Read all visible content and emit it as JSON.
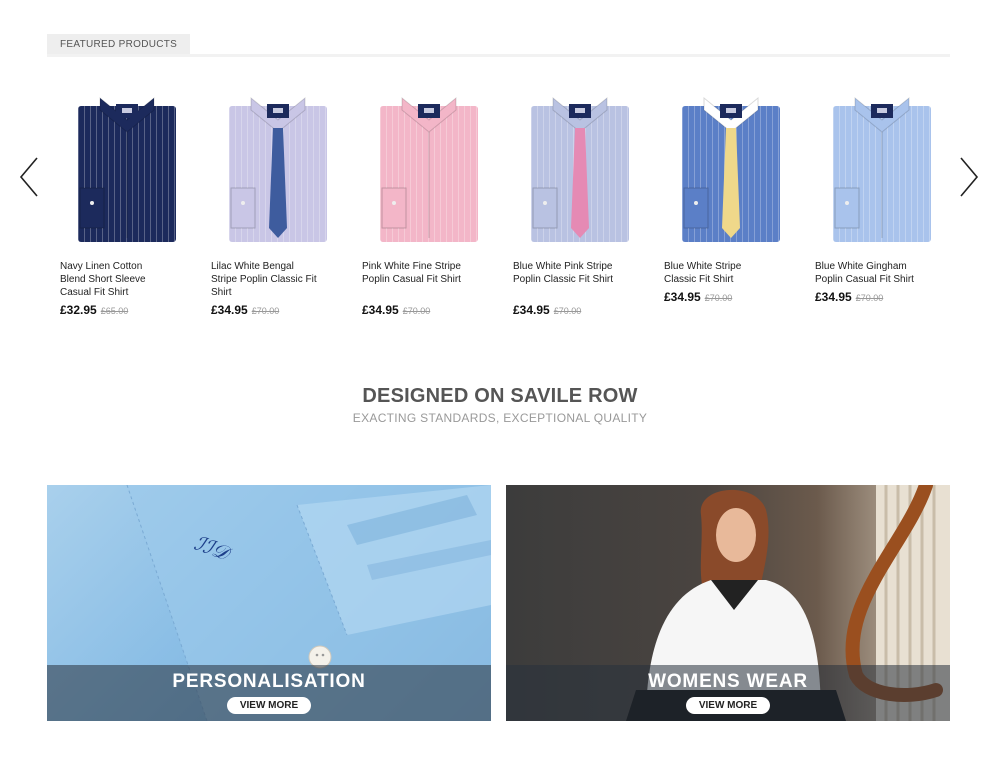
{
  "featured": {
    "tab_label": "FEATURED PRODUCTS"
  },
  "carousel": {
    "prev_icon": "chevron-left-icon",
    "next_icon": "chevron-right-icon"
  },
  "products": [
    {
      "name": "Navy Linen Cotton Blend Short Sleeve Casual Fit Shirt",
      "price": "£32.95",
      "was": "£65.00",
      "shirt_color": "#1c2a5c",
      "collar_color": "#1c2a5c",
      "tie": false,
      "tie_color": ""
    },
    {
      "name": "Lilac White Bengal Stripe Poplin Classic Fit Shirt",
      "price": "£34.95",
      "was": "£70.00",
      "shirt_color": "#c9c6e6",
      "collar_color": "#c9c6e6",
      "tie": true,
      "tie_color": "#3e5c9e"
    },
    {
      "name": "Pink White Fine Stripe Poplin Casual Fit Shirt",
      "price": "£34.95",
      "was": "£70.00",
      "shirt_color": "#f3b6c8",
      "collar_color": "#f3b6c8",
      "tie": false,
      "tie_color": ""
    },
    {
      "name": "Blue White Pink Stripe Poplin Classic Fit Shirt",
      "price": "£34.95",
      "was": "£70.00",
      "shirt_color": "#b9c2e2",
      "collar_color": "#b9c2e2",
      "tie": true,
      "tie_color": "#e58ab4"
    },
    {
      "name": "Blue White Stripe Classic Fit Shirt",
      "price": "£34.95",
      "was": "£70.00",
      "shirt_color": "#5b7fc7",
      "collar_color": "#ffffff",
      "tie": true,
      "tie_color": "#efd88a"
    },
    {
      "name": "Blue White Gingham Poplin Casual Fit Shirt",
      "price": "£34.95",
      "was": "£70.00",
      "shirt_color": "#a9c3ec",
      "collar_color": "#a9c3ec",
      "tie": false,
      "tie_color": ""
    }
  ],
  "headline": {
    "title": "DESIGNED ON SAVILE ROW",
    "subtitle": "EXACTING STANDARDS, EXCEPTIONAL QUALITY"
  },
  "banners": [
    {
      "title": "PERSONALISATION",
      "button": "VIEW MORE"
    },
    {
      "title": "WOMENS WEAR",
      "button": "VIEW MORE"
    }
  ]
}
